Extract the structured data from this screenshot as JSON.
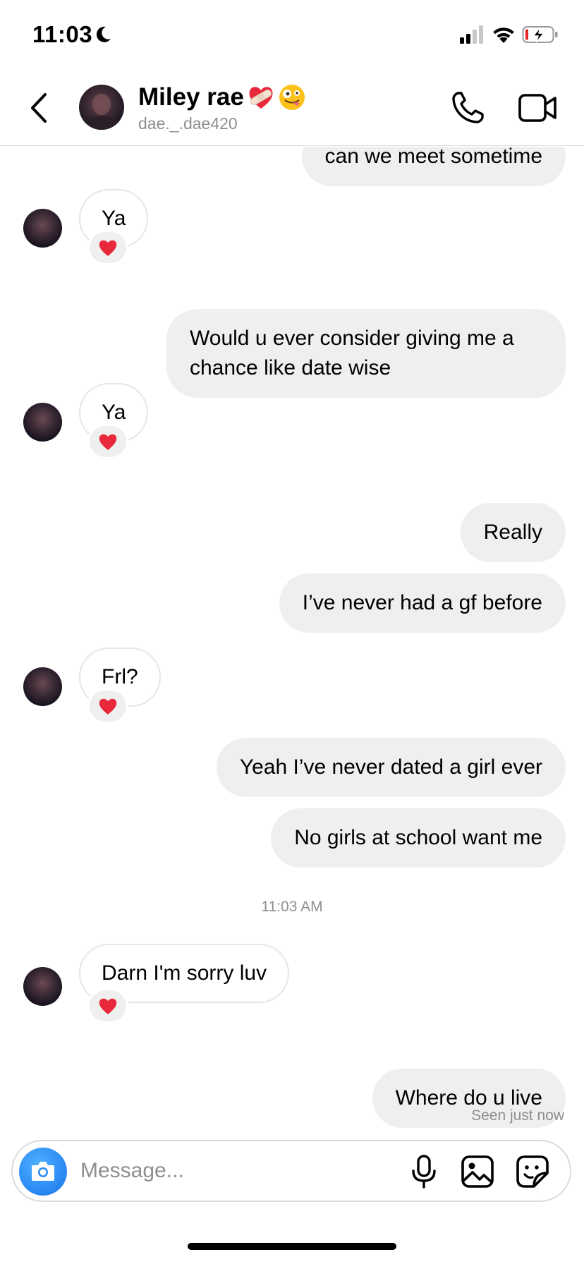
{
  "status_bar": {
    "time": "11:03",
    "icons": [
      "moon-icon",
      "signal-icon",
      "wifi-icon",
      "battery-charging-icon"
    ]
  },
  "header": {
    "name": "Miley rae",
    "name_emojis": [
      "heart-with-bandage-icon",
      "zany-face-icon"
    ],
    "username": "dae._.dae420",
    "icons": [
      "back-chevron-icon",
      "phone-icon",
      "video-camera-icon"
    ]
  },
  "chat": {
    "messages": [
      {
        "direction": "out",
        "text": "can we meet sometime"
      },
      {
        "direction": "in",
        "text": "Ya",
        "reaction": "red-heart"
      },
      {
        "direction": "out",
        "text": "Would u ever consider giving me a chance like date wise"
      },
      {
        "direction": "in",
        "text": "Ya",
        "reaction": "red-heart"
      },
      {
        "direction": "out",
        "text": "Really"
      },
      {
        "direction": "out",
        "text": "I’ve never had a gf before"
      },
      {
        "direction": "in",
        "text": "Frl?",
        "reaction": "red-heart"
      },
      {
        "direction": "out",
        "text": "Yeah I’ve never dated a girl ever"
      },
      {
        "direction": "out",
        "text": "No girls at school want me"
      },
      {
        "direction": "in",
        "text": "Darn I'm sorry luv",
        "reaction": "red-heart"
      },
      {
        "direction": "out",
        "text": "Where do u live"
      }
    ],
    "timestamp": "11:03 AM",
    "seen_status": "Seen just now"
  },
  "composer": {
    "placeholder": "Message...",
    "icons": [
      "camera-icon",
      "microphone-icon",
      "gallery-icon",
      "sticker-icon"
    ]
  },
  "colors": {
    "outgoing_bubble": "#efefef",
    "incoming_border": "#e6e6e6",
    "secondary_text": "#8e8e8e",
    "camera_button": "#2c8cf5",
    "reaction_heart": "#e8283b"
  }
}
